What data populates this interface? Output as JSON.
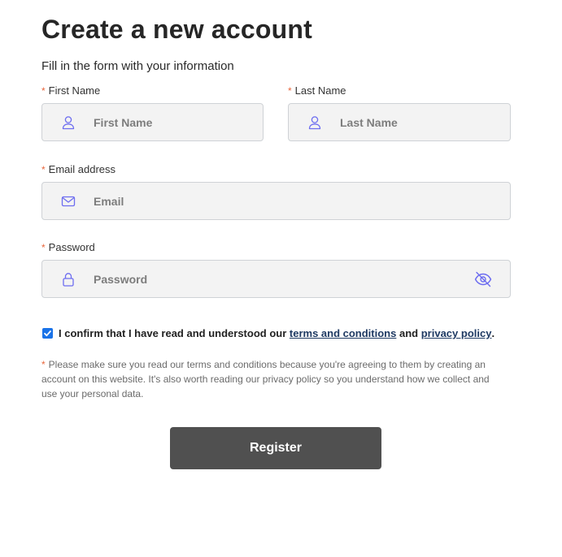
{
  "header": {
    "title": "Create a new account",
    "subtitle": "Fill in the form with your information"
  },
  "form": {
    "required_mark": "*",
    "first_name": {
      "label": "First Name",
      "placeholder": "First Name",
      "value": ""
    },
    "last_name": {
      "label": "Last Name",
      "placeholder": "Last Name",
      "value": ""
    },
    "email": {
      "label": "Email address",
      "placeholder": "Email",
      "value": ""
    },
    "password": {
      "label": "Password",
      "placeholder": "Password",
      "value": ""
    },
    "confirm": {
      "checked": true,
      "text_before": "I confirm that I have read and understood our",
      "terms_link": "terms and conditions",
      "text_middle": "and",
      "privacy_link": "privacy policy",
      "text_after": "."
    },
    "note": "Please make sure you read our terms and conditions because you're agreeing to them by creating an account on this website. It's also worth reading our privacy policy so you understand how we collect and use your personal data.",
    "register_label": "Register"
  },
  "colors": {
    "icon": "#6d6df0",
    "required": "#e8663c",
    "link": "#1f3a63",
    "button": "#505050",
    "checkbox": "#1a73e8"
  },
  "icons": {
    "first_name": "user-icon",
    "last_name": "user-icon",
    "email": "envelope-icon",
    "password": "lock-icon",
    "toggle": "eye-off-icon"
  }
}
